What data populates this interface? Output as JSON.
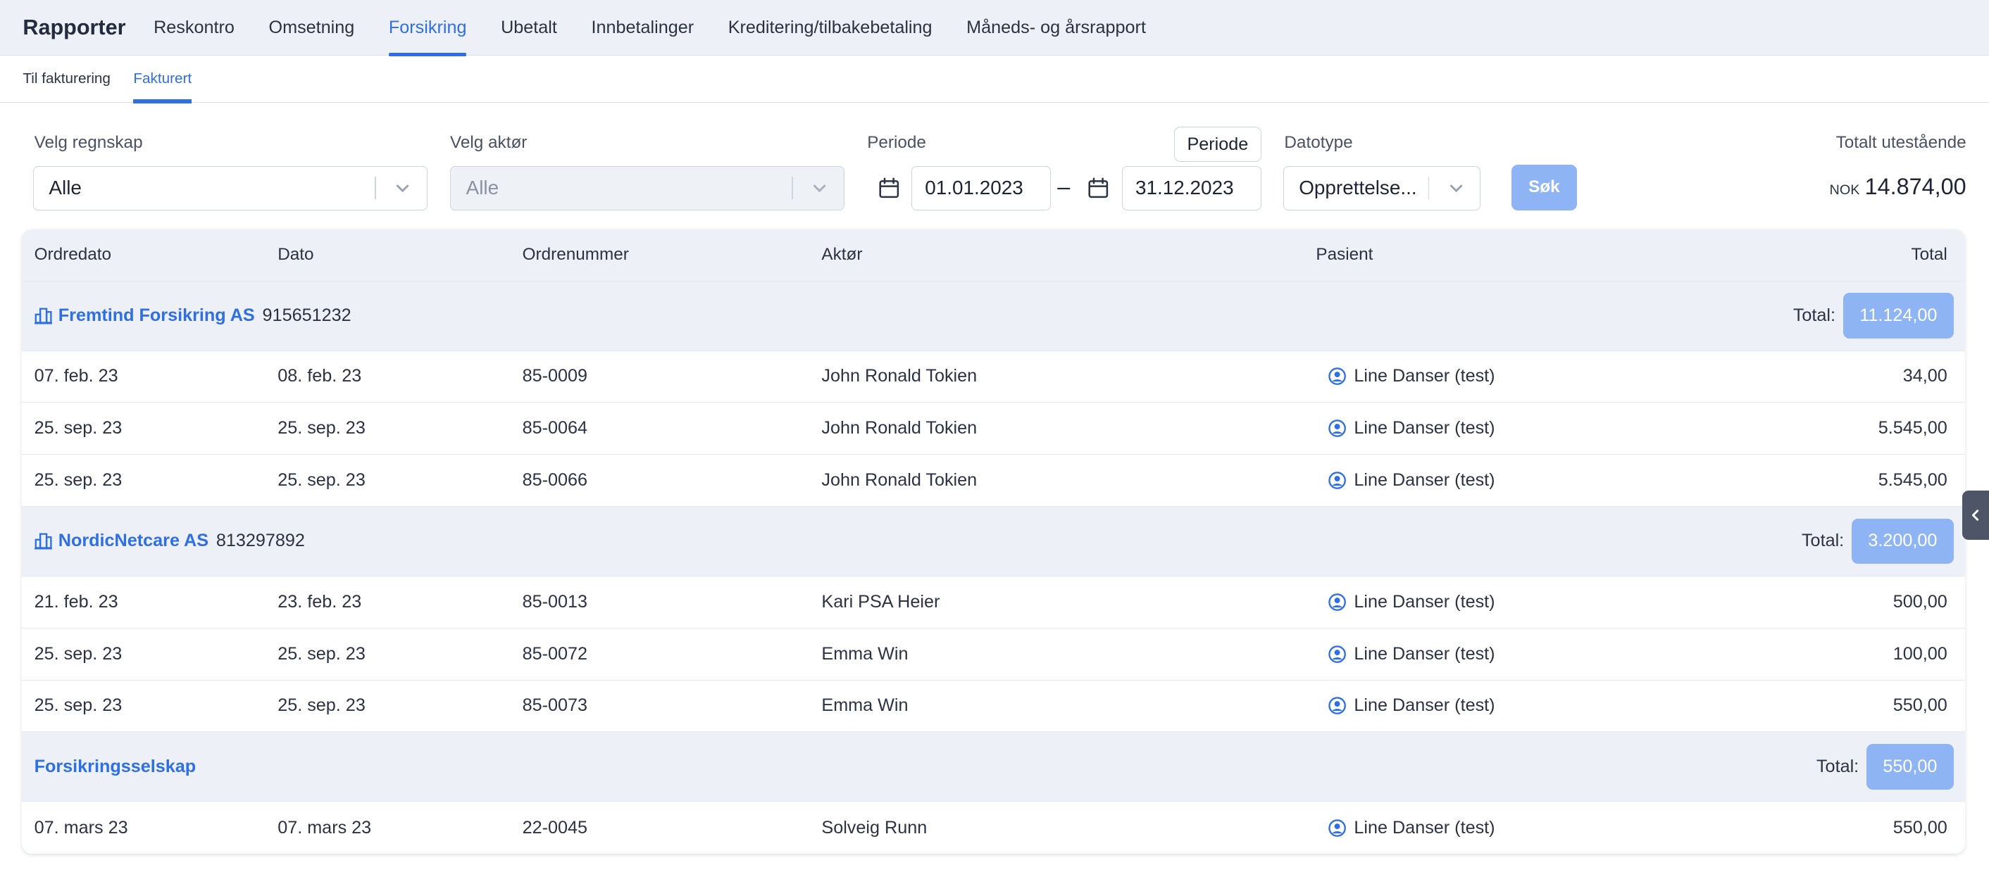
{
  "nav": {
    "brand": "Rapporter",
    "items": [
      {
        "label": "Reskontro",
        "active": false
      },
      {
        "label": "Omsetning",
        "active": false
      },
      {
        "label": "Forsikring",
        "active": true
      },
      {
        "label": "Ubetalt",
        "active": false
      },
      {
        "label": "Innbetalinger",
        "active": false
      },
      {
        "label": "Kreditering/tilbakebetaling",
        "active": false
      },
      {
        "label": "Måneds- og årsrapport",
        "active": false
      }
    ]
  },
  "subtabs": [
    {
      "label": "Til fakturering",
      "active": false
    },
    {
      "label": "Fakturert",
      "active": true
    }
  ],
  "filters": {
    "regnskap": {
      "label": "Velg regnskap",
      "value": "Alle"
    },
    "aktor": {
      "label": "Velg aktør",
      "value": "Alle",
      "disabled": true
    },
    "periode": {
      "label": "Periode",
      "button_label": "Periode",
      "from": "01.01.2023",
      "separator": "–",
      "to": "31.12.2023"
    },
    "datotype": {
      "label": "Datotype",
      "value": "Opprettelse..."
    },
    "search_label": "Søk",
    "total": {
      "label": "Totalt utestående",
      "currency": "NOK",
      "amount": "14.874,00"
    }
  },
  "table": {
    "columns": {
      "ordredato": "Ordredato",
      "dato": "Dato",
      "ordrenummer": "Ordrenummer",
      "aktor": "Aktør",
      "pasient": "Pasient",
      "total": "Total"
    },
    "total_prefix": "Total:",
    "groups": [
      {
        "name": "Fremtind Forsikring AS",
        "number": "915651232",
        "icon": "building-icon",
        "total": "11.124,00",
        "rows": [
          {
            "ordredato": "07. feb. 23",
            "dato": "08. feb. 23",
            "ordrenummer": "85-0009",
            "aktor": "John Ronald Tokien",
            "pasient": "Line Danser (test)",
            "total": "34,00"
          },
          {
            "ordredato": "25. sep. 23",
            "dato": "25. sep. 23",
            "ordrenummer": "85-0064",
            "aktor": "John Ronald Tokien",
            "pasient": "Line Danser (test)",
            "total": "5.545,00"
          },
          {
            "ordredato": "25. sep. 23",
            "dato": "25. sep. 23",
            "ordrenummer": "85-0066",
            "aktor": "John Ronald Tokien",
            "pasient": "Line Danser (test)",
            "total": "5.545,00"
          }
        ]
      },
      {
        "name": "NordicNetcare AS",
        "number": "813297892",
        "icon": "building-icon",
        "total": "3.200,00",
        "rows": [
          {
            "ordredato": "21. feb. 23",
            "dato": "23. feb. 23",
            "ordrenummer": "85-0013",
            "aktor": "Kari PSA Heier",
            "pasient": "Line Danser (test)",
            "total": "500,00"
          },
          {
            "ordredato": "25. sep. 23",
            "dato": "25. sep. 23",
            "ordrenummer": "85-0072",
            "aktor": "Emma Win",
            "pasient": "Line Danser (test)",
            "total": "100,00"
          },
          {
            "ordredato": "25. sep. 23",
            "dato": "25. sep. 23",
            "ordrenummer": "85-0073",
            "aktor": "Emma Win",
            "pasient": "Line Danser (test)",
            "total": "550,00"
          }
        ]
      },
      {
        "name": "Forsikringsselskap",
        "number": "",
        "icon": "",
        "total": "550,00",
        "rows": [
          {
            "ordredato": "07. mars 23",
            "dato": "07. mars 23",
            "ordrenummer": "22-0045",
            "aktor": "Solveig Runn",
            "pasient": "Line Danser (test)",
            "total": "550,00"
          }
        ]
      }
    ]
  },
  "colors": {
    "accent": "#2f6fe4",
    "badge": "#8fb4f4",
    "header_bg": "#edf0f6",
    "side_tab": "#4d5566"
  }
}
